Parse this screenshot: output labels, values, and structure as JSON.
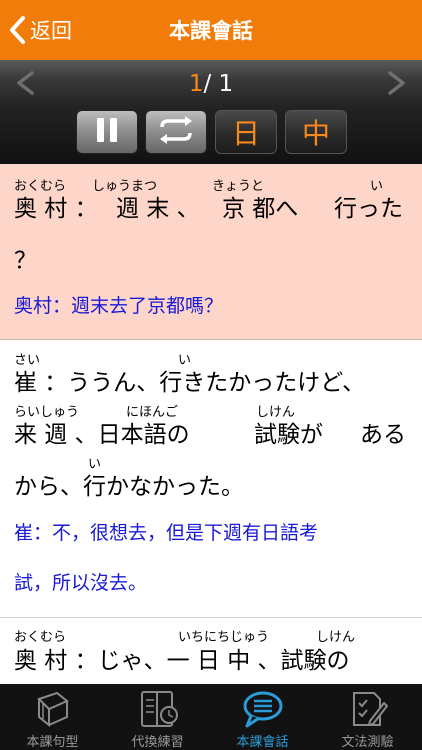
{
  "nav": {
    "back_label": "返回",
    "title": "本課會話"
  },
  "player": {
    "current": "1",
    "separator": "/",
    "total": "1",
    "jp_label": "日",
    "cn_label": "中"
  },
  "dialogue": [
    {
      "lines": [
        {
          "ruby": [
            "おくむら",
            "しゅうまつ",
            "きょうと",
            "い"
          ],
          "text": [
            "奥 村 ：",
            "週 末 、",
            "京 都へ",
            "行った"
          ]
        },
        {
          "text": [
            "？"
          ]
        }
      ],
      "translation": [
        "奥村：週末去了京都嗎？"
      ]
    },
    {
      "lines": [
        {
          "ruby": [
            "さい",
            "い"
          ],
          "text": [
            "崔 ：ううん、行きたかったけど、"
          ]
        },
        {
          "ruby": [
            "らいしゅう",
            "にほんご",
            "しけん"
          ],
          "text": [
            "来 週 、日本語の",
            "試験が",
            "ある"
          ]
        },
        {
          "ruby": [
            "い"
          ],
          "text": [
            "から、行かなかった。"
          ]
        }
      ],
      "translation": [
        "崔：不，很想去，但是下週有日語考",
        "試，所以沒去。"
      ]
    },
    {
      "lines": [
        {
          "ruby": [
            "おくむら",
            "いちにちじゅう",
            "しけん"
          ],
          "text": [
            "奥 村 ：じゃ、一 日 中 、試験の"
          ]
        }
      ]
    }
  ],
  "tabs": [
    {
      "label": "本課句型",
      "icon": "book-icon",
      "active": false
    },
    {
      "label": "代換練習",
      "icon": "notebook-clock-icon",
      "active": false
    },
    {
      "label": "本課會話",
      "icon": "chat-bubble-icon",
      "active": true
    },
    {
      "label": "文法測驗",
      "icon": "checklist-pen-icon",
      "active": false
    }
  ],
  "colors": {
    "accent": "#f27c0a",
    "highlight_bg": "#fdd5c9",
    "translation": "#1a1ad6",
    "active_tab": "#2c9cd8"
  }
}
